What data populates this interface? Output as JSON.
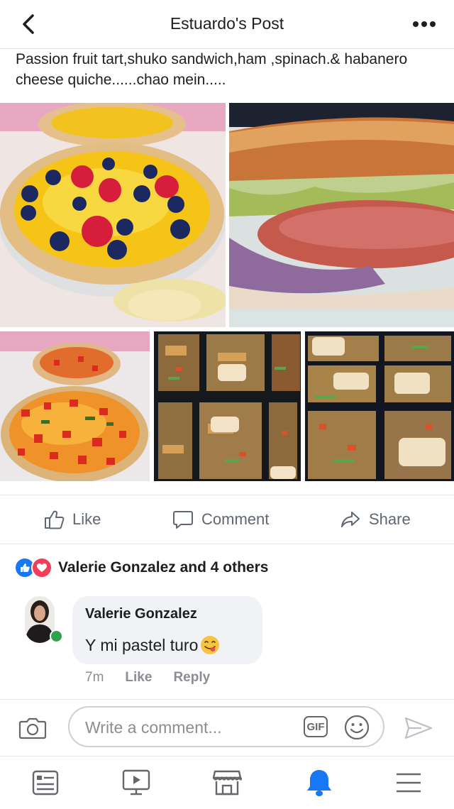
{
  "header": {
    "title": "Estuardo's Post"
  },
  "post": {
    "text": "Passion fruit tart,shuko sandwich,ham ,spinach.& habanero cheese quiche......chao mein....."
  },
  "actions": {
    "like": "Like",
    "comment": "Comment",
    "share": "Share"
  },
  "reactions": {
    "summary": "Valerie Gonzalez and 4 others"
  },
  "comment": {
    "author": "Valerie Gonzalez",
    "text": "Y mi pastel turo",
    "time": "7m",
    "like": "Like",
    "reply": "Reply"
  },
  "composer": {
    "placeholder": "Write a comment...",
    "gif": "GIF"
  },
  "colors": {
    "accent": "#1877f2",
    "love": "#f33e58",
    "online": "#31a24c",
    "muted": "#8a8d91"
  },
  "icons": [
    "back-icon",
    "more-icon",
    "thumbs-up-icon",
    "comment-icon",
    "share-icon",
    "like-reaction-icon",
    "love-reaction-icon",
    "camera-icon",
    "gif-icon",
    "emoji-icon",
    "send-icon",
    "news-feed-icon",
    "watch-icon",
    "marketplace-icon",
    "notifications-icon",
    "menu-icon"
  ]
}
